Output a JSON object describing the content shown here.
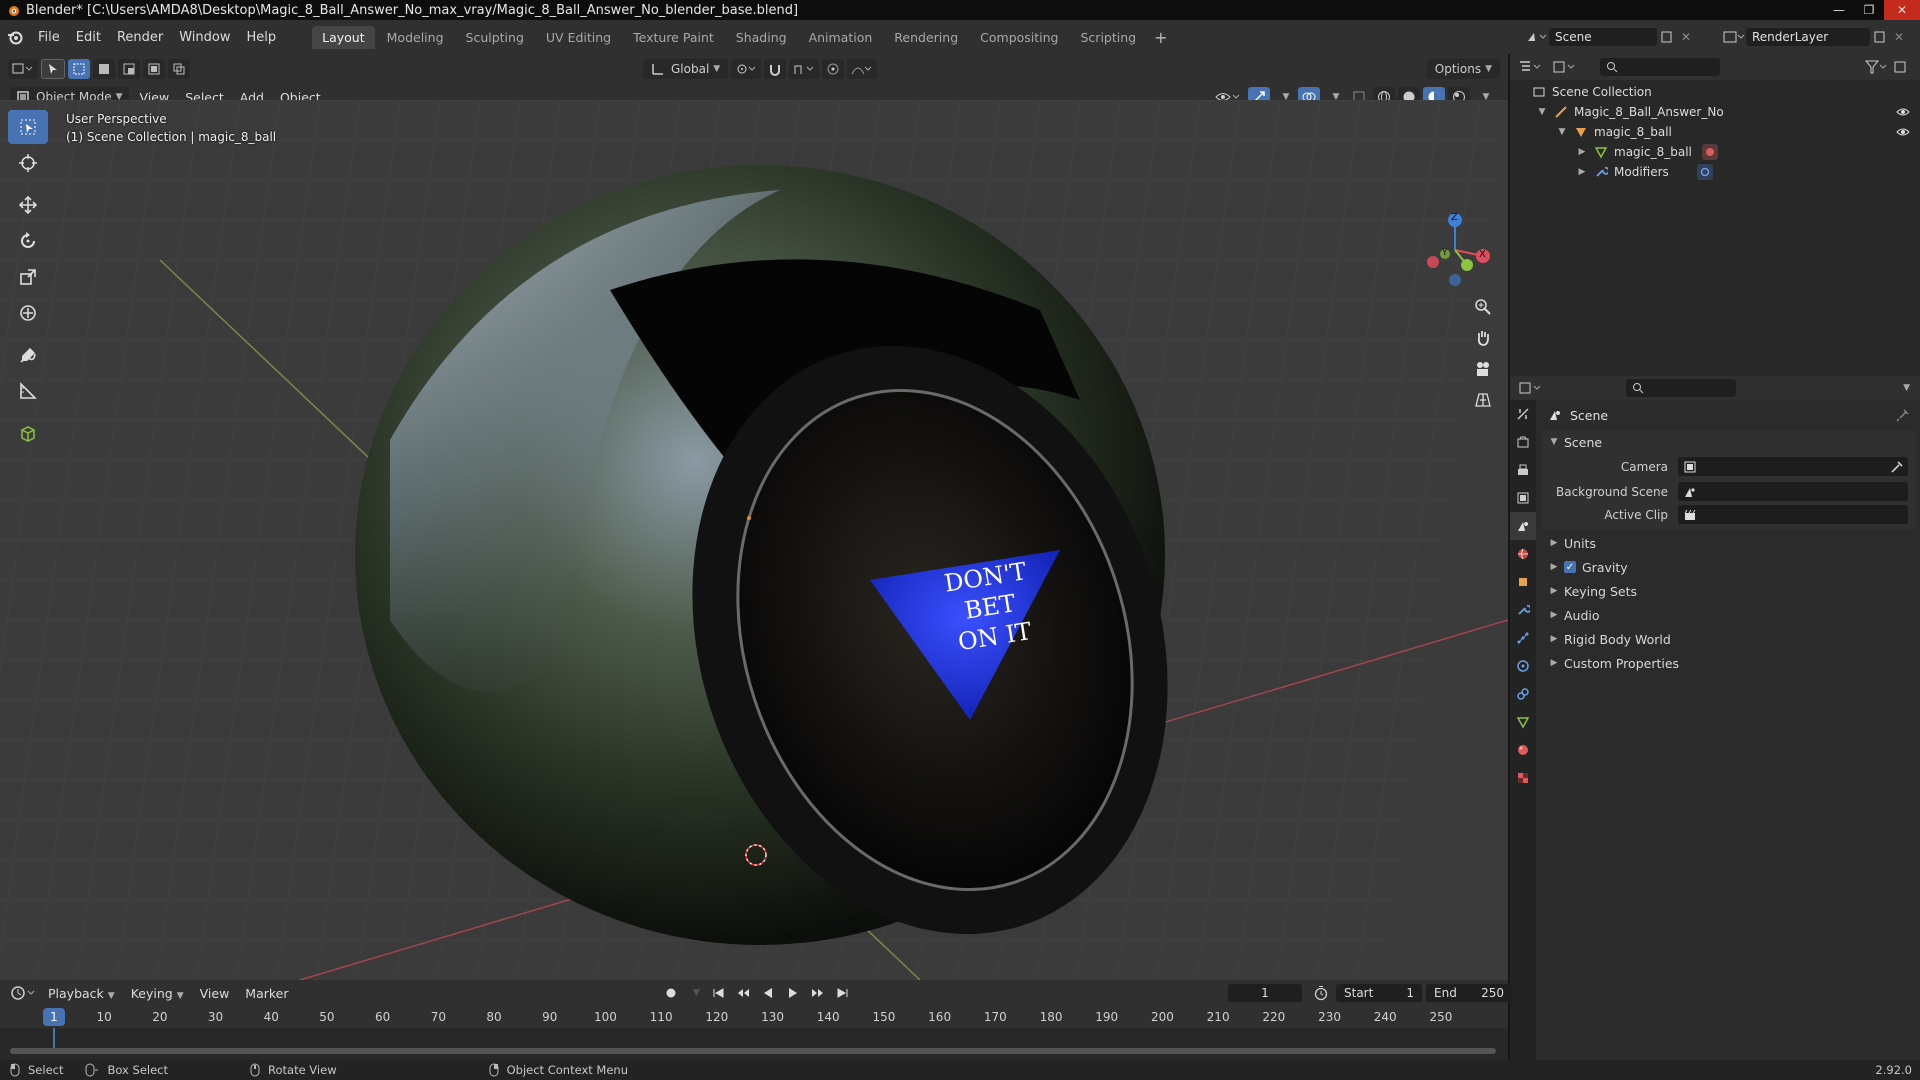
{
  "window": {
    "title": "Blender* [C:\\Users\\AMDA8\\Desktop\\Magic_8_Ball_Answer_No_max_vray/Magic_8_Ball_Answer_No_blender_base.blend]"
  },
  "menu": {
    "items": [
      "File",
      "Edit",
      "Render",
      "Window",
      "Help"
    ]
  },
  "workspaces": {
    "tabs": [
      "Layout",
      "Modeling",
      "Sculpting",
      "UV Editing",
      "Texture Paint",
      "Shading",
      "Animation",
      "Rendering",
      "Compositing",
      "Scripting"
    ],
    "active": "Layout"
  },
  "scene_selector": {
    "value": "Scene"
  },
  "renderlayer_selector": {
    "value": "RenderLayer"
  },
  "viewport_header": {
    "transform_orientation": "Global",
    "options_label": "Options",
    "mode": "Object Mode",
    "menus": [
      "View",
      "Select",
      "Add",
      "Object"
    ]
  },
  "viewport": {
    "perspective": "User Perspective",
    "collection_info": "(1) Scene Collection | magic_8_ball",
    "answer_lines": [
      "DON'T",
      "BET",
      "ON IT"
    ],
    "gizmo_axes": {
      "x": "X",
      "y": "Y",
      "z": "Z"
    }
  },
  "outliner": {
    "root": "Scene Collection",
    "items": [
      {
        "label": "Magic_8_Ball_Answer_No",
        "depth": 1
      },
      {
        "label": "magic_8_ball",
        "depth": 2
      },
      {
        "label": "magic_8_ball",
        "depth": 3
      },
      {
        "label": "Modifiers",
        "depth": 3
      }
    ]
  },
  "properties": {
    "context": "Scene",
    "panel_title": "Scene",
    "fields": [
      {
        "label": "Camera"
      },
      {
        "label": "Background Scene"
      },
      {
        "label": "Active Clip"
      }
    ],
    "collapsed_panels": [
      "Units",
      "Gravity",
      "Keying Sets",
      "Audio",
      "Rigid Body World",
      "Custom Properties"
    ]
  },
  "timeline": {
    "menus": [
      "Playback",
      "Keying",
      "View",
      "Marker"
    ],
    "current_frame": "1",
    "start_label": "Start",
    "start_value": "1",
    "end_label": "End",
    "end_value": "250",
    "ticks": [
      "10",
      "20",
      "30",
      "40",
      "50",
      "60",
      "70",
      "80",
      "90",
      "100",
      "110",
      "120",
      "130",
      "140",
      "150",
      "160",
      "170",
      "180",
      "190",
      "200",
      "210",
      "220",
      "230",
      "240",
      "250"
    ]
  },
  "statusbar": {
    "items": [
      "Select",
      "Box Select",
      "Rotate View",
      "Object Context Menu"
    ],
    "version": "2.92.0"
  },
  "colors": {
    "accent": "#4772b3",
    "answer_blue": "#1a2bd6",
    "axis_x": "#e34b5b",
    "axis_y": "#8bc43f",
    "axis_z": "#3d7fd9"
  }
}
